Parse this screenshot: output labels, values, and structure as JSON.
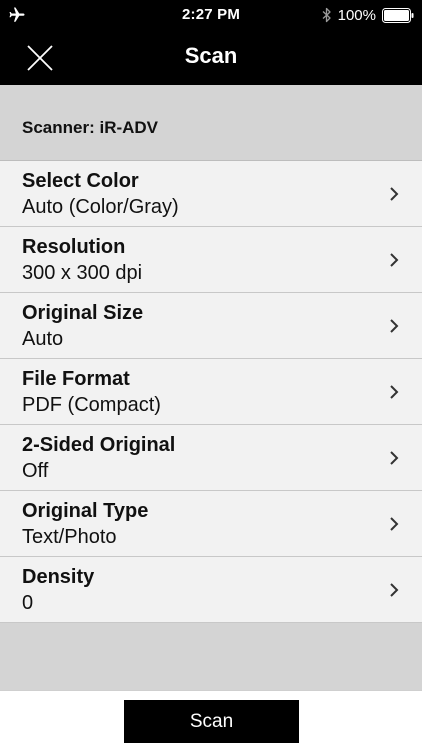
{
  "status_bar": {
    "time": "2:27 PM",
    "battery_percent": "100%",
    "icons": [
      "airplane-icon",
      "bluetooth-icon",
      "battery-icon"
    ]
  },
  "nav": {
    "title": "Scan",
    "close_icon": "close-icon"
  },
  "scanner": {
    "label": "Scanner: iR-ADV"
  },
  "settings": [
    {
      "title": "Select Color",
      "value": "Auto (Color/Gray)"
    },
    {
      "title": "Resolution",
      "value": "300 x 300 dpi"
    },
    {
      "title": "Original Size",
      "value": "Auto"
    },
    {
      "title": "File Format",
      "value": "PDF (Compact)"
    },
    {
      "title": "2-Sided Original",
      "value": "Off"
    },
    {
      "title": "Original Type",
      "value": "Text/Photo"
    },
    {
      "title": "Density",
      "value": "0"
    }
  ],
  "footer": {
    "scan_button_label": "Scan"
  },
  "colors": {
    "bar_background": "#000000",
    "header_background": "#d4d4d4",
    "row_background": "#f2f2f2",
    "button_background": "#000000"
  }
}
